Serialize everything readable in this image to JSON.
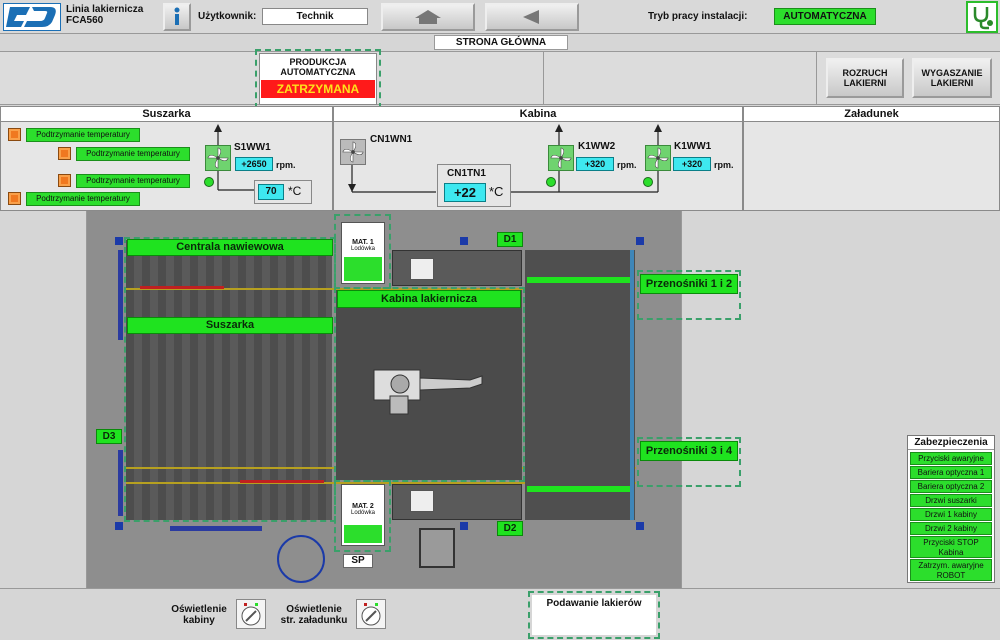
{
  "header": {
    "logo_text": "CD",
    "app_title_line1": "Linia lakiernicza",
    "app_title_line2": "FCA560",
    "user_label": "Użytkownik:",
    "user_value": "Technik",
    "mode_label": "Tryb pracy instalacji:",
    "mode_value": "AUTOMATYCZNA"
  },
  "page_title": "STRONA GŁÓWNA",
  "production": {
    "title_line1": "PRODUKCJA",
    "title_line2": "AUTOMATYCZNA",
    "status": "ZATRZYMANA"
  },
  "buttons": {
    "start_line1": "ROZRUCH",
    "start_line2": "LAKIERNI",
    "stop_line1": "WYGASZANIE",
    "stop_line2": "LAKIERNI"
  },
  "sections": {
    "dryer": "Suszarka",
    "booth": "Kabina",
    "loading": "Załadunek"
  },
  "dryer": {
    "hold_buttons": [
      "Podtrzymanie temperatury",
      "Podtrzymanie temperatury",
      "Podtrzymanie temperatury",
      "Podtrzymanie temperatury"
    ],
    "fan_name": "S1WW1",
    "fan_speed": "+2650",
    "rpm_unit": "rpm.",
    "temp_value": "70",
    "temp_unit": "*C"
  },
  "booth": {
    "fan1_name": "CN1WN1",
    "fan2_name": "K1WW2",
    "fan2_speed": "+320",
    "fan3_name": "K1WW1",
    "fan3_speed": "+320",
    "rpm_unit": "rpm.",
    "temp_name": "CN1TN1",
    "temp_value": "+22",
    "temp_unit": "*C"
  },
  "layout_zones": {
    "central": "Centrala nawiewowa",
    "dryer": "Suszarka",
    "booth": "Kabina lakiernicza",
    "conveyor12": "Przenośniki 1 i 2",
    "conveyor34": "Przenośniki 3 i 4",
    "mat1_line1": "MAT. 1",
    "mat1_line2": "Lodówka",
    "mat2_line1": "MAT. 2",
    "mat2_line2": "Lodówka",
    "d1": "D1",
    "d2": "D2",
    "d3": "D3",
    "sp": "SP"
  },
  "safety": {
    "title": "Zabezpieczenia",
    "items": [
      "Przyciski awaryjne",
      "Bariera optyczna 1",
      "Bariera optyczna 2",
      "Drzwi suszarki",
      "Drzwi 1 kabiny",
      "Drzwi 2 kabiny",
      "Przyciski STOP Kabina",
      "Zatrzym. awaryjne ROBOT"
    ]
  },
  "footer": {
    "light1_line1": "Oświetlenie",
    "light1_line2": "kabiny",
    "light2_line1": "Oświetlenie",
    "light2_line2": "str. załadunku",
    "paint_supply": "Podawanie lakierów"
  },
  "colors": {
    "status_green": "#2cde2c",
    "alarm_red": "#ff1a1a",
    "value_cyan": "#3ee8f0"
  }
}
